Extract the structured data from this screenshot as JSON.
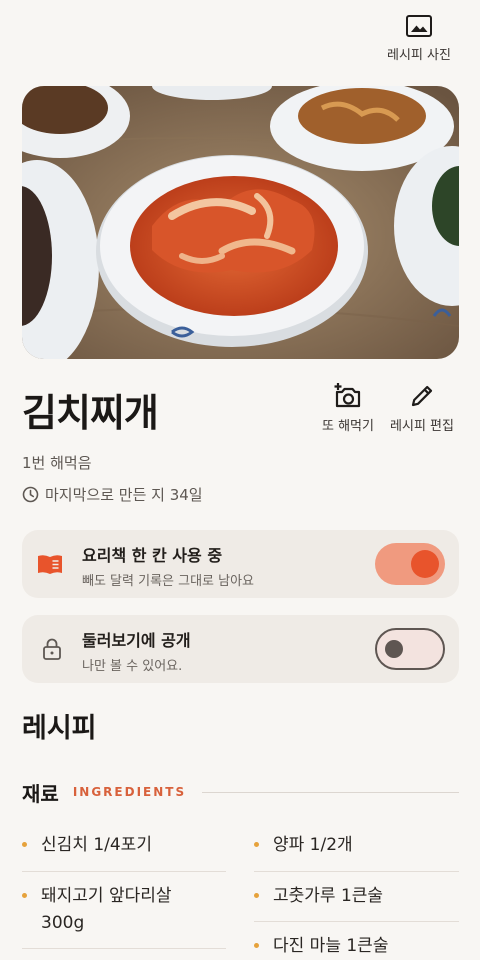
{
  "header": {
    "photo_action_label": "레시피 사진",
    "photo_icon": "image-icon"
  },
  "recipe": {
    "title": "김치찌개",
    "cook_count": "1번 해먹음",
    "last_made": "마지막으로 만든 지 34일"
  },
  "actions": {
    "cook_again_label": "또 해먹기",
    "edit_label": "레시피 편집"
  },
  "cookbook_card": {
    "title": "요리책 한 칸 사용 중",
    "subtitle": "빼도 달력 기록은 그대로 남아요",
    "toggle_on": true
  },
  "public_card": {
    "title": "둘러보기에 공개",
    "subtitle": "나만 볼 수 있어요.",
    "toggle_on": false
  },
  "section": {
    "recipe_title": "레시피",
    "ingredients_ko": "재료",
    "ingredients_en": "INGREDIENTS"
  },
  "ingredients": {
    "left": [
      "신김치 1/4포기",
      "돼지고기 앞다리살 300g"
    ],
    "right": [
      "양파 1/2개",
      "고춧가루 1큰술",
      "다진 마늘 1큰술"
    ]
  },
  "colors": {
    "accent": "#e8542c",
    "bullet": "#e6a23c",
    "toggle_on_track": "#f09a7f"
  }
}
